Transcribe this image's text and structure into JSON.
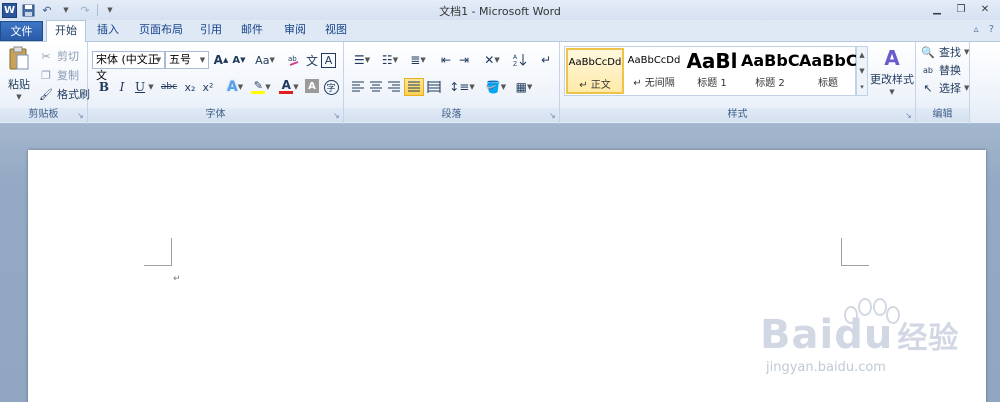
{
  "window": {
    "title": "文档1 - Microsoft Word",
    "app_icon_letter": "W"
  },
  "qat": {
    "save_icon": "save-icon",
    "undo_icon": "undo-icon",
    "redo_icon": "redo-icon"
  },
  "tabs": {
    "file": "文件",
    "home": "开始",
    "insert": "插入",
    "layout": "页面布局",
    "references": "引用",
    "mailings": "邮件",
    "review": "审阅",
    "view": "视图"
  },
  "clipboard": {
    "paste": "粘贴",
    "cut": "剪切",
    "copy": "复制",
    "format_painter": "格式刷",
    "label": "剪贴板"
  },
  "font": {
    "name": "宋体 (中文正文",
    "size": "五号",
    "label": "字体",
    "aa": "Aa",
    "wen": "文",
    "grow": "A",
    "shrink": "A",
    "a_char": "A",
    "char_shading": "A",
    "enclose": "字",
    "pinyin": "文",
    "bold": "B",
    "italic": "I",
    "underline": "U",
    "strike": "abc",
    "subscript": "x₂",
    "superscript": "x²"
  },
  "paragraph": {
    "label": "段落"
  },
  "styles": {
    "label": "样式",
    "change_styles": "更改样式",
    "items": [
      {
        "sample": "AaBbCcDd",
        "name": "正文",
        "prefix": "↵ "
      },
      {
        "sample": "AaBbCcDd",
        "name": "无间隔",
        "prefix": "↵ "
      },
      {
        "sample": "AaBl",
        "name": "标题 1",
        "prefix": ""
      },
      {
        "sample": "AaBbC",
        "name": "标题 2",
        "prefix": ""
      },
      {
        "sample": "AaBbC",
        "name": "标题",
        "prefix": ""
      }
    ]
  },
  "editing": {
    "label": "编辑",
    "find": "查找",
    "replace": "替换",
    "select": "选择"
  },
  "watermark": {
    "brand_a": "Bai",
    "brand_b": "du",
    "brand_cn": "经验",
    "url": "jingyan.baidu.com"
  },
  "colors": {
    "accent": "#2b579a",
    "highlight": "#ffd04e",
    "font_color": "#e02020",
    "highlight_color": "#ffff00"
  }
}
